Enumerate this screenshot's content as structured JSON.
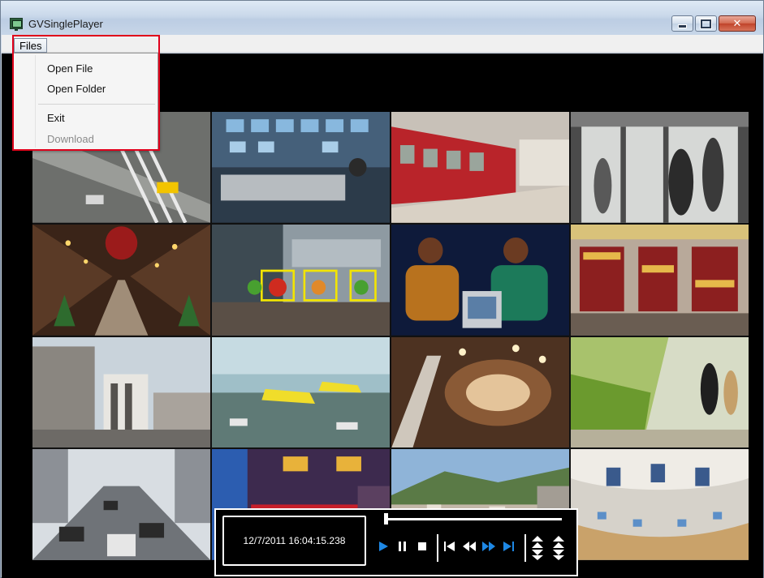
{
  "window": {
    "title": "GVSinglePlayer",
    "buttons": [
      "minimize",
      "maximize",
      "close"
    ],
    "close_glyph": "✕"
  },
  "menubar": {
    "files_label": "Files"
  },
  "files_menu": {
    "items": [
      {
        "label": "Open File",
        "enabled": true
      },
      {
        "label": "Open Folder",
        "enabled": true
      },
      {
        "label": "Exit",
        "enabled": true
      },
      {
        "label": "Download",
        "enabled": false
      }
    ]
  },
  "playback": {
    "timestamp": "12/7/2011 16:04:15.238",
    "position_fraction": 0.0,
    "buttons": [
      "play-icon",
      "pause-icon",
      "stop-icon",
      "skip-to-start-icon",
      "rewind-icon",
      "fast-forward-icon",
      "skip-to-end-icon",
      "speed-up-icon",
      "speed-down-icon"
    ],
    "accent_color": "#1e88e5"
  },
  "camera_grid": {
    "columns": 4,
    "rows": 4,
    "cameras": [
      {
        "scene": "city intersection aerial"
      },
      {
        "scene": "control room monitors"
      },
      {
        "scene": "train station platform"
      },
      {
        "scene": "revolving door entrance"
      },
      {
        "scene": "shopping arcade"
      },
      {
        "scene": "object tracking demo"
      },
      {
        "scene": "children with computers"
      },
      {
        "scene": "retail store shelves"
      },
      {
        "scene": "city buildings"
      },
      {
        "scene": "airport apron"
      },
      {
        "scene": "mall atrium escalators"
      },
      {
        "scene": "produce market"
      },
      {
        "scene": "highway traffic"
      },
      {
        "scene": "store counter"
      },
      {
        "scene": "city panorama"
      },
      {
        "scene": "service hall desks"
      }
    ]
  },
  "highlight_color": "#e0001b"
}
